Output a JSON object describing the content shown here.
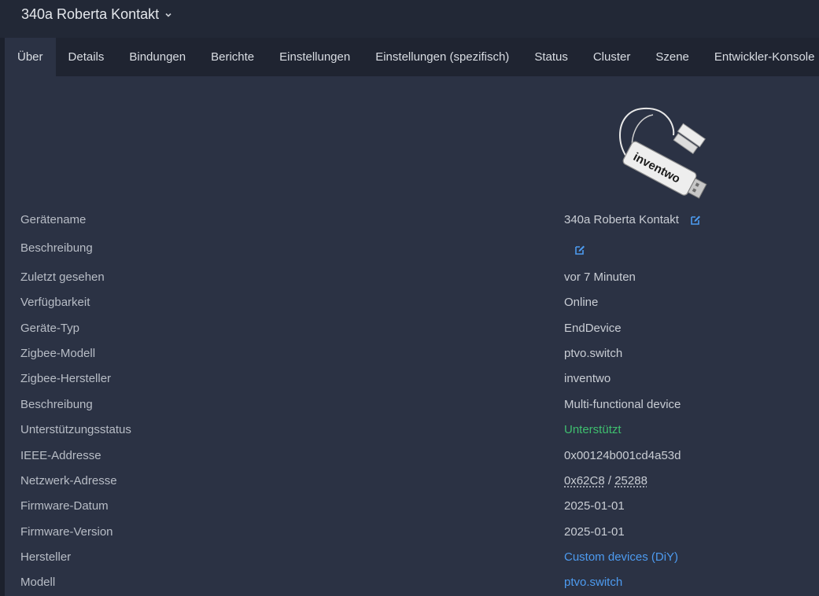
{
  "header": {
    "device_title": "340a Roberta Kontakt"
  },
  "tabs": [
    {
      "label": "Über",
      "active": true
    },
    {
      "label": "Details"
    },
    {
      "label": "Bindungen"
    },
    {
      "label": "Berichte"
    },
    {
      "label": "Einstellungen"
    },
    {
      "label": "Einstellungen (spezifisch)"
    },
    {
      "label": "Status"
    },
    {
      "label": "Cluster"
    },
    {
      "label": "Szene"
    },
    {
      "label": "Entwickler-Konsole"
    }
  ],
  "device_image": {
    "brand_text": "inventwo"
  },
  "props": {
    "device_name": {
      "label": "Gerätename",
      "value": "340a Roberta Kontakt"
    },
    "description_edit": {
      "label": "Beschreibung",
      "value": ""
    },
    "last_seen": {
      "label": "Zuletzt gesehen",
      "value": "vor 7 Minuten"
    },
    "availability": {
      "label": "Verfügbarkeit",
      "value": "Online"
    },
    "device_type": {
      "label": "Geräte-Typ",
      "value": "EndDevice"
    },
    "zigbee_model": {
      "label": "Zigbee-Modell",
      "value": "ptvo.switch"
    },
    "zigbee_vendor": {
      "label": "Zigbee-Hersteller",
      "value": "inventwo"
    },
    "description": {
      "label": "Beschreibung",
      "value": "Multi-functional device"
    },
    "support_status": {
      "label": "Unterstützungsstatus",
      "value": "Unterstützt"
    },
    "ieee_address": {
      "label": "IEEE-Addresse",
      "value": "0x00124b001cd4a53d"
    },
    "network_address": {
      "label": "Netzwerk-Adresse",
      "hex": "0x62C8",
      "separator": " / ",
      "dec": "25288"
    },
    "firmware_date": {
      "label": "Firmware-Datum",
      "value": "2025-01-01"
    },
    "firmware_version": {
      "label": "Firmware-Version",
      "value": "2025-01-01"
    },
    "manufacturer": {
      "label": "Hersteller",
      "value": "Custom devices (DiY)"
    },
    "model": {
      "label": "Modell",
      "value": "ptvo.switch"
    }
  },
  "colors": {
    "background": "#2b3244",
    "tabbar": "#1f2431",
    "link": "#4d9bf0",
    "success": "#3fbf6f"
  },
  "icons": {
    "edit": "edit-icon",
    "title_dropdown": "chevron-down-icon"
  }
}
